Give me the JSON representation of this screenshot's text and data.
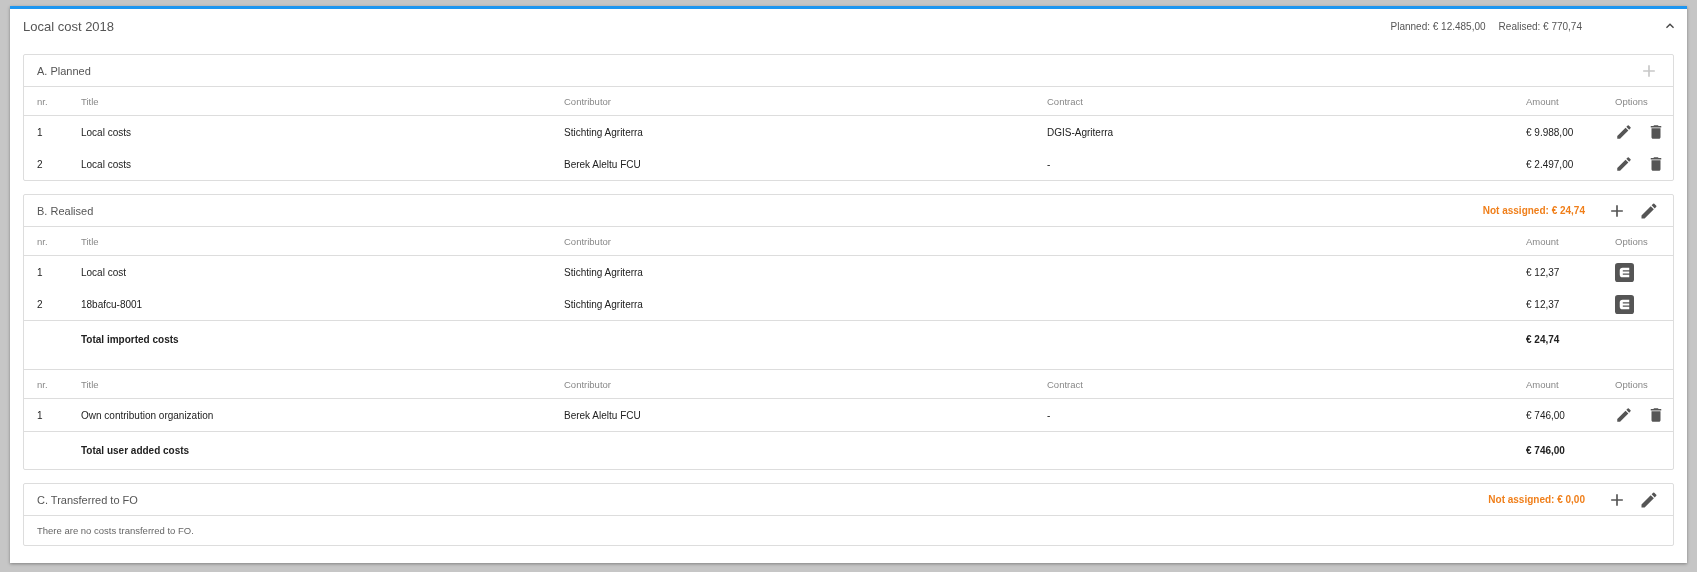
{
  "panel": {
    "title": "Local cost 2018",
    "summary": [
      "Planned: € 12.485,00",
      "Realised: € 770,74"
    ],
    "expanded": true
  },
  "sections": [
    {
      "title": "A. Planned",
      "actions": [
        {
          "kind": "add",
          "disabled": true
        }
      ],
      "tables": [
        {
          "columns": [
            {
              "kind": "nr",
              "label": "nr."
            },
            {
              "kind": "title",
              "label": "Title"
            },
            {
              "kind": "contributor",
              "label": "Contributor"
            },
            {
              "kind": "contract",
              "label": "Contract"
            },
            {
              "kind": "amount",
              "label": "Amount"
            },
            {
              "kind": "options",
              "label": "Options"
            }
          ],
          "rows": [
            {
              "nr": "1",
              "title": "Local costs",
              "contributor": "Stichting Agriterra",
              "contract": "DGIS-Agriterra",
              "amount": "€ 9.988,00",
              "options": [
                {
                  "kind": "edit"
                },
                {
                  "kind": "delete"
                }
              ]
            },
            {
              "nr": "2",
              "title": "Local costs",
              "contributor": "Berek Aleltu FCU",
              "contract": "-",
              "amount": "€ 2.497,00",
              "options": [
                {
                  "kind": "edit"
                },
                {
                  "kind": "delete"
                }
              ]
            }
          ]
        }
      ]
    },
    {
      "title": "B. Realised",
      "not_assigned": "Not assigned: € 24,74",
      "actions": [
        {
          "kind": "add",
          "disabled": false
        },
        {
          "kind": "edit",
          "disabled": false
        }
      ],
      "tables": [
        {
          "columns": [
            {
              "kind": "nr",
              "label": "nr."
            },
            {
              "kind": "title",
              "label": "Title"
            },
            {
              "kind": "contributor",
              "label": "Contributor"
            },
            {
              "kind": "amount",
              "label": "Amount"
            },
            {
              "kind": "options",
              "label": "Options"
            }
          ],
          "rows": [
            {
              "nr": "1",
              "title": "Local cost",
              "contributor": "Stichting Agriterra",
              "amount": "€ 12,37",
              "options": [
                {
                  "kind": "imported"
                }
              ]
            },
            {
              "nr": "2",
              "title": "18bafcu-8001",
              "contributor": "Stichting Agriterra",
              "amount": "€ 12,37",
              "options": [
                {
                  "kind": "imported"
                }
              ]
            }
          ],
          "total": {
            "label": "Total imported costs",
            "amount": "€ 24,74"
          }
        },
        {
          "columns": [
            {
              "kind": "nr",
              "label": "nr."
            },
            {
              "kind": "title",
              "label": "Title"
            },
            {
              "kind": "contributor",
              "label": "Contributor"
            },
            {
              "kind": "contract",
              "label": "Contract"
            },
            {
              "kind": "amount",
              "label": "Amount"
            },
            {
              "kind": "options",
              "label": "Options"
            }
          ],
          "rows": [
            {
              "nr": "1",
              "title": "Own contribution organization",
              "contributor": "Berek Aleltu FCU",
              "contract": "-",
              "amount": "€ 746,00",
              "options": [
                {
                  "kind": "edit"
                },
                {
                  "kind": "delete"
                }
              ]
            }
          ],
          "total": {
            "label": "Total user added costs",
            "amount": "€ 746,00"
          }
        }
      ]
    },
    {
      "title": "C. Transferred to FO",
      "not_assigned": "Not assigned: € 0,00",
      "actions": [
        {
          "kind": "add",
          "disabled": false
        },
        {
          "kind": "edit",
          "disabled": false
        }
      ],
      "empty_message": "There are no costs transferred to FO."
    }
  ]
}
